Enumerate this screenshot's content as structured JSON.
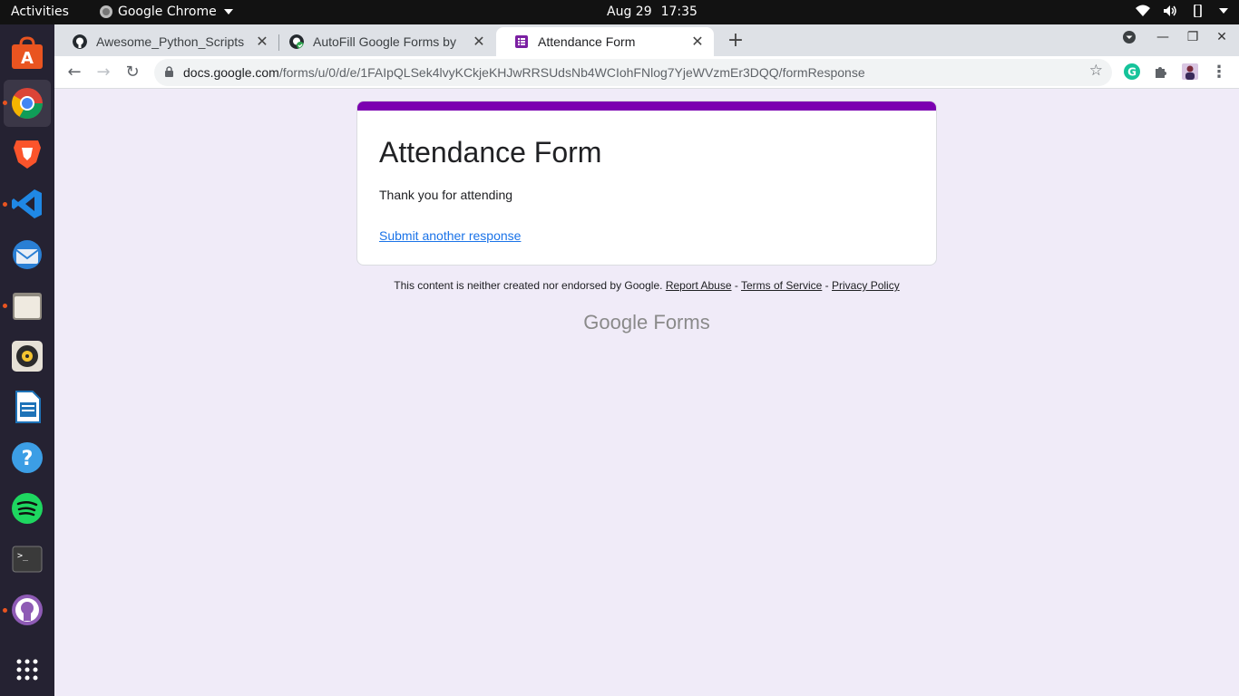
{
  "topbar": {
    "activities": "Activities",
    "app_name": "Google Chrome",
    "date": "Aug 29",
    "time": "17:35"
  },
  "dock": {
    "apps": [
      {
        "name": "ubuntu-software-icon",
        "color": "#e95420"
      },
      {
        "name": "chrome-icon",
        "color": "#4285f4"
      },
      {
        "name": "brave-icon",
        "color": "#fb542b"
      },
      {
        "name": "vscode-icon",
        "color": "#1f88e5"
      },
      {
        "name": "thunderbird-icon",
        "color": "#2a7fd4"
      },
      {
        "name": "files-icon",
        "color": "#d9d4c9"
      },
      {
        "name": "rhythmbox-icon",
        "color": "#f4c430"
      },
      {
        "name": "libreoffice-writer-icon",
        "color": "#1e73b8"
      },
      {
        "name": "help-icon",
        "color": "#3c9ee5"
      },
      {
        "name": "spotify-icon",
        "color": "#1ed760"
      },
      {
        "name": "terminal-icon",
        "color": "#3a3a3a"
      },
      {
        "name": "github-desktop-icon",
        "color": "#8e5bb5"
      }
    ],
    "show_apps_icon": "grid-icon"
  },
  "tabs": [
    {
      "title": "Awesome_Python_Scripts",
      "icon": "github-icon"
    },
    {
      "title": "AutoFill Google Forms by",
      "icon": "github-check-icon"
    },
    {
      "title": "Attendance Form",
      "icon": "google-forms-icon",
      "active": true
    }
  ],
  "toolbar": {
    "url_host": "docs.google.com",
    "url_path": "/forms/u/0/d/e/1FAIpQLSek4lvyKCkjeKHJwRRSUdsNb4WCIohFNlog7YjeWVzmEr3DQQ/formResponse"
  },
  "form": {
    "title": "Attendance Form",
    "message": "Thank you for attending",
    "link": "Submit another response",
    "accent_color": "#7b00b0"
  },
  "footer": {
    "disclaimer": "This content is neither created nor endorsed by Google.",
    "report_abuse": "Report Abuse",
    "sep1": " - ",
    "terms": "Terms of Service",
    "sep2": " - ",
    "privacy": "Privacy Policy",
    "brand_google": "Google",
    "brand_forms": "Forms"
  }
}
